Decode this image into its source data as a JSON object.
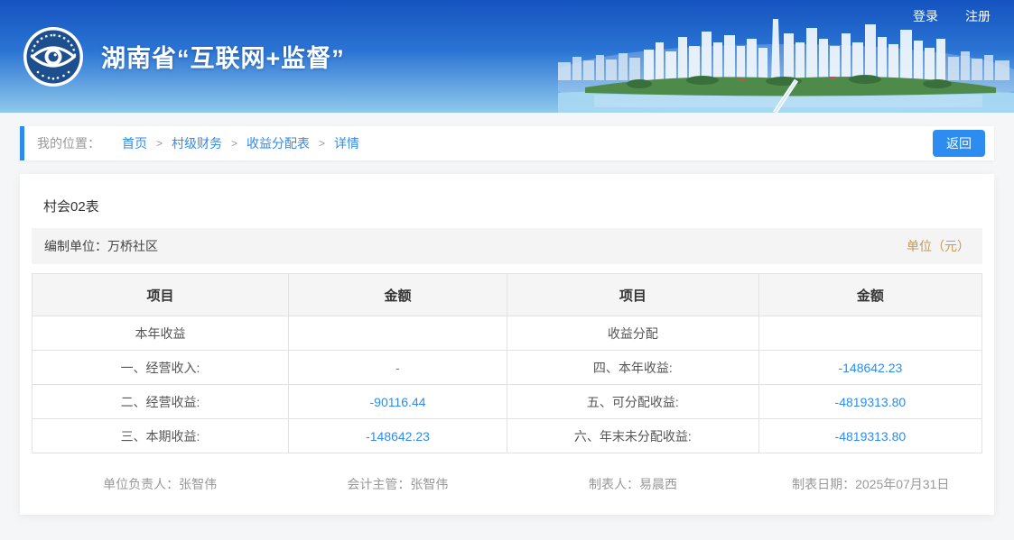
{
  "header": {
    "login_label": "登录",
    "register_label": "注册",
    "title": "湖南省“互联网+监督”",
    "logo": "eye-supervision-logo",
    "banner_art": "city-skyline-illustration",
    "gradient_top": "#1453bf",
    "gradient_bottom": "#8fc9ec"
  },
  "breadcrumb": {
    "prefix": "我的位置：",
    "separator": ">",
    "items": [
      "首页",
      "村级财务",
      "收益分配表",
      "详情"
    ],
    "back_label": "返回"
  },
  "report": {
    "sheet_code": "村会02表",
    "prepared_label": "编制单位：",
    "prepared_value": "万桥社区",
    "unit_note": "单位（元）",
    "columns": [
      "项目",
      "金额",
      "项目",
      "金额"
    ],
    "rows": [
      {
        "left_item": "本年收益",
        "left_value": "",
        "right_item": "收益分配",
        "right_value": ""
      },
      {
        "left_item": "一、经营收入:",
        "left_value": "-",
        "right_item": "四、本年收益:",
        "right_value": "-148642.23"
      },
      {
        "left_item": "二、经营收益:",
        "left_value": "-90116.44",
        "right_item": "五、可分配收益:",
        "right_value": "-4819313.80"
      },
      {
        "left_item": "三、本期收益:",
        "left_value": "-148642.23",
        "right_item": "六、年末未分配收益:",
        "right_value": "-4819313.80"
      }
    ],
    "signers": [
      {
        "label": "单位负责人：",
        "value": "张智伟"
      },
      {
        "label": "会计主管：",
        "value": "张智伟"
      },
      {
        "label": "制表人：",
        "value": "易晨西"
      },
      {
        "label": "制表日期：",
        "value": "2025年07月31日"
      }
    ]
  },
  "colors": {
    "accent_blue": "#2d8cf0",
    "value_blue": "#2d8cf0",
    "unit_gold": "#c49a54",
    "table_border": "#e2e2e2",
    "header_row_bg": "#f5f5f5"
  }
}
